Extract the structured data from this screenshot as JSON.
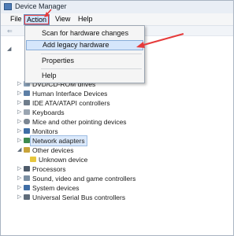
{
  "window": {
    "title": "Device Manager",
    "accent": "#e63b3b"
  },
  "menubar": {
    "items": [
      "File",
      "Action",
      "View",
      "Help"
    ]
  },
  "toolbar": {
    "back_glyph": "⇐"
  },
  "dropdown": {
    "items": [
      {
        "label": "Scan for hardware changes",
        "highlighted": false
      },
      {
        "label": "Add legacy hardware",
        "highlighted": true
      },
      {
        "label": "Properties",
        "highlighted": false
      },
      {
        "label": "Help",
        "highlighted": false
      }
    ]
  },
  "tree": {
    "items": [
      {
        "label": "DVD/CD-ROM drives",
        "icon": "dvd-icon",
        "expander": "▷"
      },
      {
        "label": "Human Interface Devices",
        "icon": "hid-icon",
        "expander": "▷"
      },
      {
        "label": "IDE ATA/ATAPI controllers",
        "icon": "ide-icon",
        "expander": "▷"
      },
      {
        "label": "Keyboards",
        "icon": "keyboard-icon",
        "expander": "▷"
      },
      {
        "label": "Mice and other pointing devices",
        "icon": "mouse-icon",
        "expander": "▷"
      },
      {
        "label": "Monitors",
        "icon": "monitor-icon",
        "expander": "▷"
      },
      {
        "label": "Network adapters",
        "icon": "network-icon",
        "expander": "▷",
        "selected": true
      },
      {
        "label": "Other devices",
        "icon": "other-devices-icon",
        "expander": "◢"
      },
      {
        "label": "Unknown device",
        "icon": "warning-icon",
        "expander": "",
        "child": true
      },
      {
        "label": "Processors",
        "icon": "processor-icon",
        "expander": "▷"
      },
      {
        "label": "Sound, video and game controllers",
        "icon": "sound-icon",
        "expander": "▷"
      },
      {
        "label": "System devices",
        "icon": "system-icon",
        "expander": "▷"
      },
      {
        "label": "Universal Serial Bus controllers",
        "icon": "usb-icon",
        "expander": "▷"
      }
    ]
  }
}
